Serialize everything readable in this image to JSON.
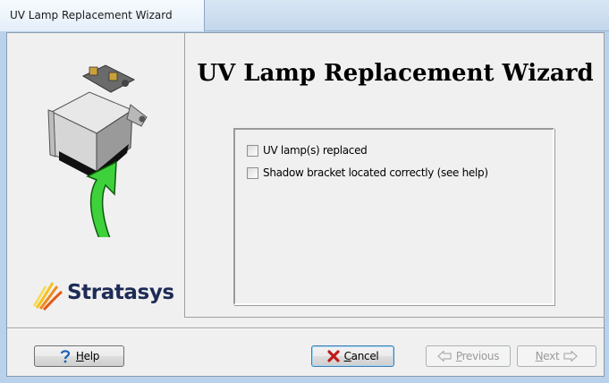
{
  "window": {
    "title": "UV Lamp Replacement Wizard"
  },
  "side_panel": {
    "logo_text": "Stratasys"
  },
  "main": {
    "heading": "UV Lamp Replacement Wizard",
    "checklist": [
      {
        "label": "UV lamp(s) replaced",
        "checked": false
      },
      {
        "label": "Shadow bracket located correctly (see help)",
        "checked": false
      }
    ]
  },
  "buttons": {
    "help": {
      "label": "Help",
      "enabled": true
    },
    "cancel": {
      "label": "Cancel",
      "enabled": true
    },
    "previous": {
      "label": "Previous",
      "enabled": false
    },
    "next": {
      "label": "Next",
      "enabled": false
    }
  },
  "colors": {
    "title_tab": "#eaf2fb",
    "client_bg": "#f0f0f0",
    "arrow_green": "#3fd13b",
    "logo_navy": "#1d2b55",
    "logo_orange": "#f08a1c",
    "cancel_x": "#c01a1a"
  },
  "icons": {
    "help": "question-mark-icon",
    "cancel": "red-x-icon",
    "previous": "left-arrow-icon",
    "next": "right-arrow-icon"
  }
}
